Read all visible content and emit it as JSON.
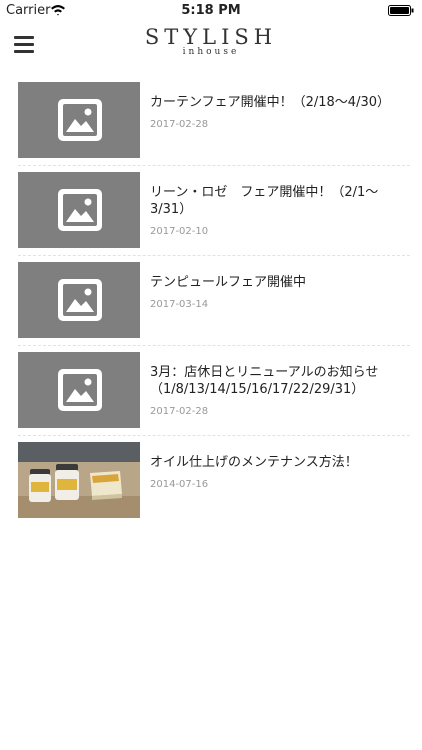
{
  "status_bar": {
    "carrier": "Carrier",
    "time": "5:18 PM"
  },
  "header": {
    "logo_title": "STYLISH",
    "logo_subtitle": "inhouse"
  },
  "articles": [
    {
      "title": "カーテンフェア開催中！（2/18〜4/30）",
      "date": "2017-02-28",
      "thumb": "placeholder"
    },
    {
      "title": "リーン・ロゼ　フェア開催中！（2/1〜3/31）",
      "date": "2017-02-10",
      "thumb": "placeholder"
    },
    {
      "title": "テンピュールフェア開催中",
      "date": "2017-03-14",
      "thumb": "placeholder"
    },
    {
      "title": "3月：店休日とリニューアルのお知らせ（1/8/13/14/15/16/17/22/29/31）",
      "date": "2017-02-28",
      "thumb": "placeholder"
    },
    {
      "title": "オイル仕上げのメンテナンス方法！",
      "date": "2014-07-16",
      "thumb": "photo"
    }
  ]
}
